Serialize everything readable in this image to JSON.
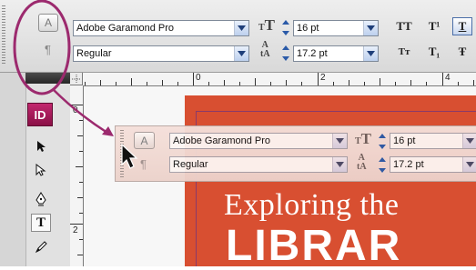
{
  "control_panel": {
    "font_family": "Adobe Garamond Pro",
    "font_style": "Regular",
    "font_size": "16 pt",
    "leading": "17.2 pt",
    "character_mode_label": "A",
    "paragraph_mode_label": "¶",
    "buttons": {
      "all_caps": "TT",
      "superscript": "T¹",
      "underline": "T",
      "small_caps": "Tт",
      "subscript": "T₁",
      "strikethrough": "Ŧ"
    }
  },
  "rulers": {
    "horizontal_marks": [
      "0",
      "2",
      "4"
    ],
    "vertical_marks": [
      "0",
      "2"
    ]
  },
  "tools": {
    "app_logo": "ID",
    "type_tool_label": "T"
  },
  "document": {
    "title_line1": "Exploring the",
    "title_line2": "LIBRAR"
  },
  "callout": {
    "font_family": "Adobe Garamond Pro",
    "font_style": "Regular",
    "font_size": "16 pt",
    "leading": "17.2 pt",
    "character_mode_label": "A",
    "paragraph_mode_label": "¶"
  },
  "colors": {
    "annotation_accent": "#9c2a6e",
    "cover_orange": "#d84f31",
    "indesign_logo": "#a81b5a"
  },
  "icons": [
    "grip-handle-icon",
    "character-mode-icon",
    "paragraph-mode-icon",
    "font-size-icon",
    "leading-icon",
    "dropdown-arrow-icon",
    "selection-tool-icon",
    "direct-selection-tool-icon",
    "pen-tool-icon",
    "type-tool-icon",
    "pencil-tool-icon",
    "mouse-cursor-icon"
  ]
}
